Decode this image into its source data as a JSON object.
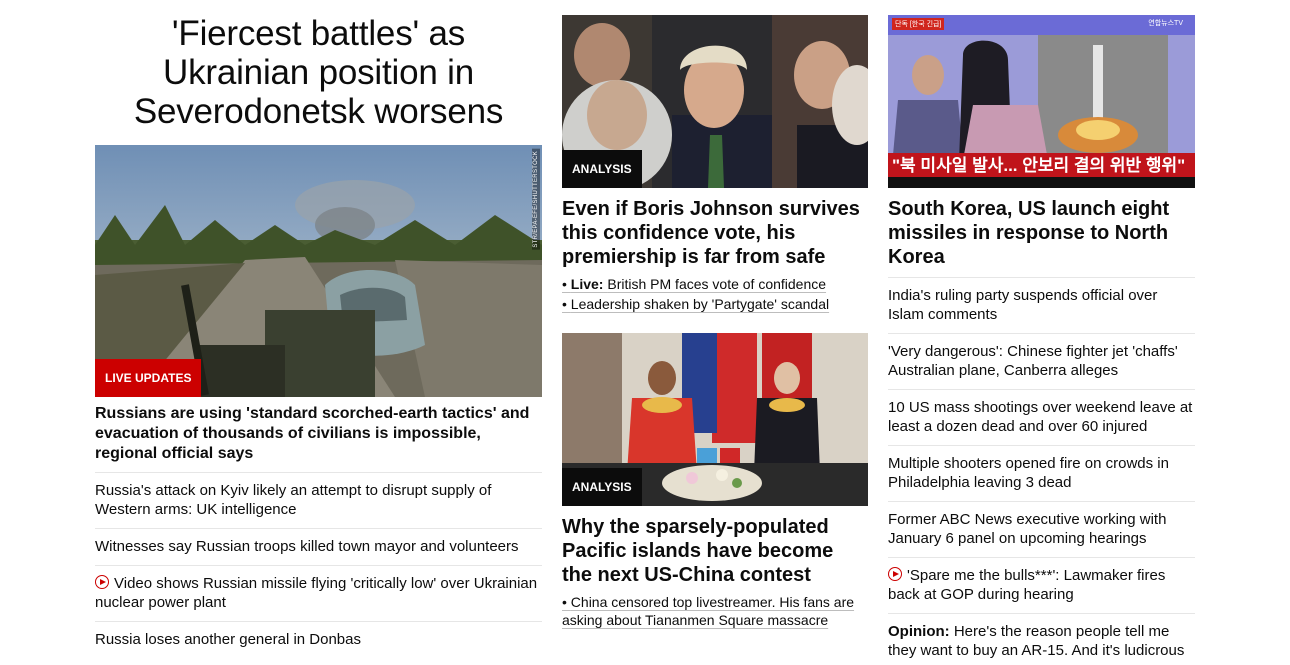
{
  "column1": {
    "hero_headline": "'Fiercest battles' as Ukrainian position in Severodonetsk worsens",
    "image_credit": "STR/EPA-EFE/SHUTTERSTOCK",
    "label": "LIVE UPDATES",
    "lead_story": "Russians are using 'standard scorched-earth tactics' and evacuation of thousands of civilians is impossible, regional official says",
    "items": [
      {
        "text": "Russia's attack on Kyiv likely an attempt to disrupt supply of Western arms: UK intelligence"
      },
      {
        "text": "Witnesses say Russian troops killed town mayor and volunteers"
      },
      {
        "text": "Video shows Russian missile flying 'critically low' over Ukrainian nuclear power plant",
        "icon": "play-icon"
      },
      {
        "text": "Russia loses another general in Donbas"
      }
    ]
  },
  "column2": {
    "card1": {
      "label": "ANALYSIS",
      "headline": "Even if Boris Johnson survives this confidence vote, his premiership is far from safe",
      "bullet1_prefix": "Live:",
      "bullet1_text": "British PM faces vote of confidence",
      "bullet2_text": "Leadership shaken by 'Partygate' scandal"
    },
    "card2": {
      "label": "ANALYSIS",
      "headline": "Why the sparsely-populated Pacific islands have become the next US-China contest",
      "bullet1_text": "China censored top livestreamer. His fans are asking about Tiananmen Square massacre"
    }
  },
  "column3": {
    "image_overlay_text": "\"북 미사일 발사... 안보리 결의 위반 행위\"",
    "image_corner_text": "연합뉴스TV",
    "image_tag": "단독 [한국 긴급]",
    "headline": "South Korea, US launch eight missiles in response to North Korea",
    "items": [
      {
        "text": "India's ruling party suspends official over Islam comments"
      },
      {
        "text": "'Very dangerous': Chinese fighter jet 'chaffs' Australian plane, Canberra alleges"
      },
      {
        "text": "10 US mass shootings over weekend leave at least a dozen dead and over 60 injured"
      },
      {
        "text": "Multiple shooters opened fire on crowds in Philadelphia leaving 3 dead"
      },
      {
        "text": "Former ABC News executive working with January 6 panel on upcoming hearings"
      },
      {
        "text": "'Spare me the bulls***': Lawmaker fires back at GOP during hearing",
        "icon": "play-icon"
      }
    ],
    "opinion_prefix": "Opinion:",
    "opinion_text": "Here's the reason people tell me they want to buy an AR-15. And it's ludicrous"
  },
  "colors": {
    "accent_red": "#cc0000",
    "text": "#0c0c0c",
    "divider": "#e6e6e6"
  }
}
